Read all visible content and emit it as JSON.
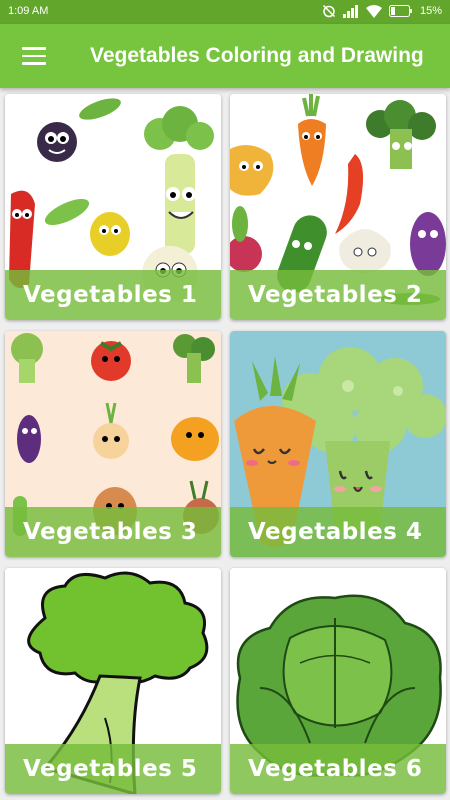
{
  "status_bar": {
    "time": "1:09 AM",
    "battery": "15%",
    "icons": [
      "alarm-off-icon",
      "signal-icon",
      "wifi-icon",
      "battery-icon"
    ]
  },
  "app_bar": {
    "title": "Vegetables Coloring and Drawing",
    "menu_icon": "hamburger-menu-icon",
    "color": "#77c43f",
    "status_color": "#62a72c"
  },
  "cards": [
    {
      "label": "Vegetables 1"
    },
    {
      "label": "Vegetables 2"
    },
    {
      "label": "Vegetables 3"
    },
    {
      "label": "Vegetables 4"
    },
    {
      "label": "Vegetables 5"
    },
    {
      "label": "Vegetables 6"
    }
  ]
}
